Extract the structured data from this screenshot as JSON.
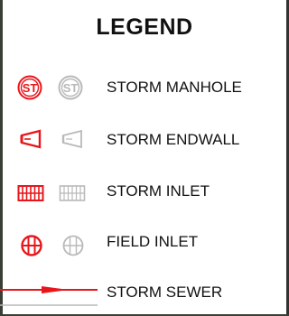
{
  "legend": {
    "title": "LEGEND",
    "items": [
      {
        "key": "storm_manhole",
        "label": "STORM MANHOLE",
        "symbol_text": "ST"
      },
      {
        "key": "storm_endwall",
        "label": "STORM ENDWALL"
      },
      {
        "key": "storm_inlet",
        "label": "STORM INLET"
      },
      {
        "key": "field_inlet",
        "label": "FIELD INLET"
      },
      {
        "key": "storm_sewer",
        "label": "STORM SEWER"
      }
    ]
  },
  "colors": {
    "active": "#e8161b",
    "inactive": "#b9b9b9",
    "text": "#111111",
    "map_edge": "#3a3f36"
  },
  "icons": {
    "storm_manhole": "storm-manhole-icon",
    "storm_endwall": "storm-endwall-icon",
    "storm_inlet": "storm-inlet-icon",
    "field_inlet": "field-inlet-icon",
    "storm_sewer": "storm-sewer-line-icon"
  }
}
